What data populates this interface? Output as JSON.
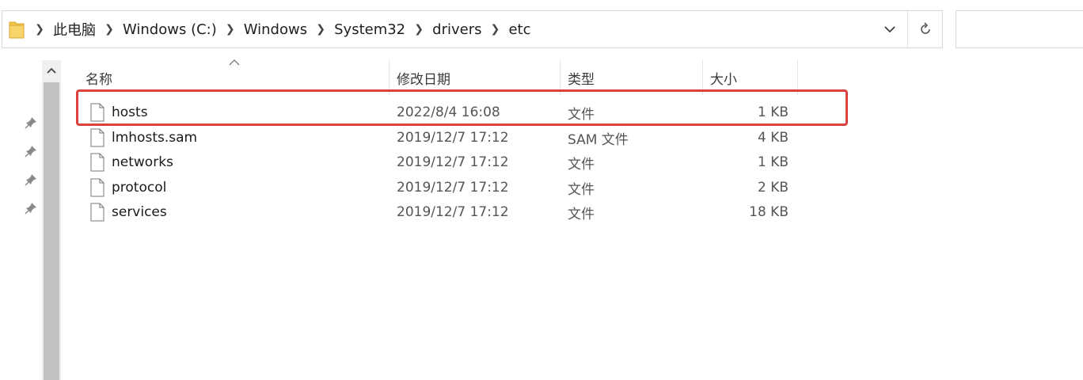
{
  "address": {
    "crumbs": [
      "此电脑",
      "Windows (C:)",
      "Windows",
      "System32",
      "drivers",
      "etc"
    ]
  },
  "columns": {
    "name": "名称",
    "date": "修改日期",
    "type": "类型",
    "size": "大小"
  },
  "files": [
    {
      "name": "hosts",
      "date": "2022/8/4 16:08",
      "type": "文件",
      "size": "1 KB"
    },
    {
      "name": "lmhosts.sam",
      "date": "2019/12/7 17:12",
      "type": "SAM 文件",
      "size": "4 KB"
    },
    {
      "name": "networks",
      "date": "2019/12/7 17:12",
      "type": "文件",
      "size": "1 KB"
    },
    {
      "name": "protocol",
      "date": "2019/12/7 17:12",
      "type": "文件",
      "size": "2 KB"
    },
    {
      "name": "services",
      "date": "2019/12/7 17:12",
      "type": "文件",
      "size": "18 KB"
    }
  ],
  "icons": {
    "folder": "folder-icon",
    "file": "file-icon",
    "pin": "pin-icon",
    "refresh": "refresh-icon",
    "dropdown": "chevron-down-icon"
  },
  "colors": {
    "highlight": "#e0403c",
    "folder": "#f2c94c"
  }
}
